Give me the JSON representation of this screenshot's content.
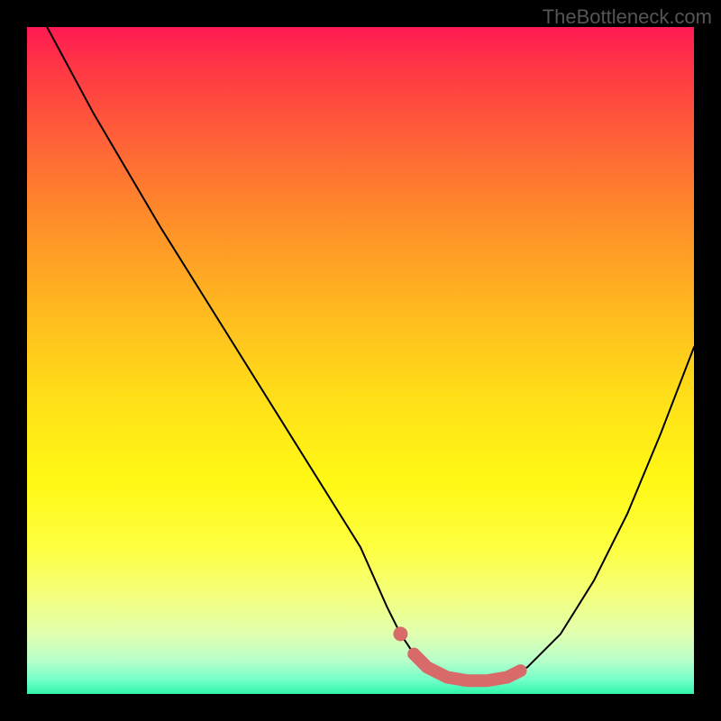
{
  "watermark": "TheBottleneck.com",
  "chart_data": {
    "type": "line",
    "title": "",
    "xlabel": "",
    "ylabel": "",
    "xlim": [
      0,
      100
    ],
    "ylim": [
      0,
      100
    ],
    "series": [
      {
        "name": "curve",
        "x": [
          3,
          10,
          20,
          30,
          40,
          50,
          54,
          56,
          58,
          60,
          63,
          66,
          69,
          72,
          75,
          80,
          85,
          90,
          95,
          100
        ],
        "y": [
          100,
          87,
          70,
          54,
          38,
          22,
          13,
          9,
          6,
          4,
          2.5,
          2,
          2,
          2.5,
          4,
          9,
          17,
          27,
          39,
          52
        ]
      }
    ],
    "highlight": {
      "name": "marker-band",
      "color": "#d86a6a",
      "x": [
        56,
        58,
        60,
        63,
        66,
        69,
        72,
        74
      ],
      "y": [
        9,
        6,
        4,
        2.5,
        2,
        2,
        2.5,
        3.5
      ]
    },
    "gradient_stops": [
      {
        "pos": 0,
        "color": "#ff1a53"
      },
      {
        "pos": 6,
        "color": "#ff3645"
      },
      {
        "pos": 15,
        "color": "#ff5a3a"
      },
      {
        "pos": 28,
        "color": "#ff8a2a"
      },
      {
        "pos": 42,
        "color": "#ffb820"
      },
      {
        "pos": 56,
        "color": "#ffe018"
      },
      {
        "pos": 68,
        "color": "#fff814"
      },
      {
        "pos": 78,
        "color": "#fdff40"
      },
      {
        "pos": 85,
        "color": "#f4ff7a"
      },
      {
        "pos": 91,
        "color": "#e0ffb0"
      },
      {
        "pos": 95,
        "color": "#b8ffca"
      },
      {
        "pos": 98,
        "color": "#70ffc8"
      },
      {
        "pos": 100,
        "color": "#30f5a8"
      }
    ]
  }
}
